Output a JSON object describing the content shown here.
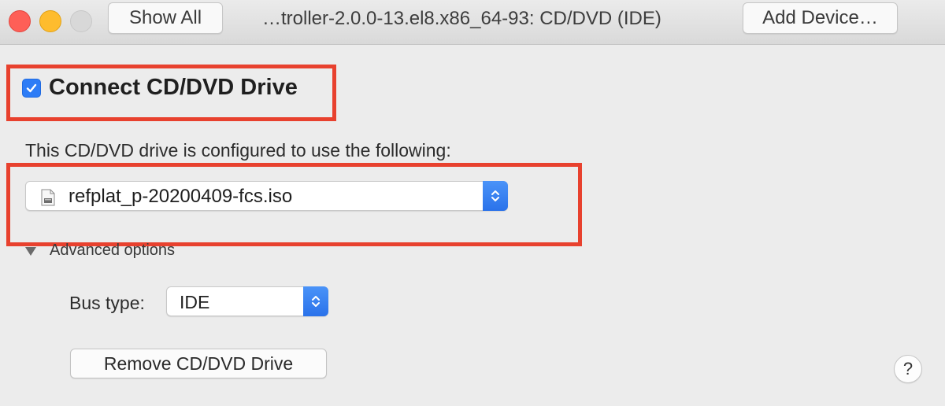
{
  "window": {
    "title": "…troller-2.0.0-13.el8.x86_64-93: CD/DVD (IDE)",
    "show_all_label": "Show All",
    "add_device_label": "Add Device…"
  },
  "connect": {
    "label": "Connect CD/DVD Drive",
    "checked": true
  },
  "config": {
    "description": "This CD/DVD drive is configured to use the following:",
    "selected_file": "refplat_p-20200409-fcs.iso"
  },
  "advanced": {
    "label": "Advanced options",
    "expanded": true,
    "bus_type_label": "Bus type:",
    "bus_type_value": "IDE",
    "remove_label": "Remove CD/DVD Drive"
  },
  "help": {
    "label": "?"
  },
  "colors": {
    "accent": "#2d7cf6",
    "highlight": "#e8412e",
    "background": "#ececec"
  },
  "icons": [
    "close-icon",
    "minimize-icon",
    "zoom-icon",
    "checkmark-icon",
    "disc-image-file-icon",
    "popup-stepper-icon",
    "disclosure-triangle-icon"
  ]
}
